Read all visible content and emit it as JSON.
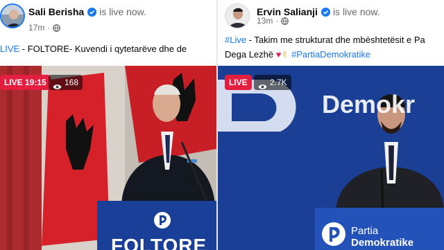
{
  "posts": [
    {
      "author": "Sali Berisha",
      "status": "is live now.",
      "time": "17m",
      "text_hashtag": "LIVE",
      "text_body": " - FOLTORE- Kuvendi i qytetarëve dhe de",
      "badge_live": "LIVE 19:15",
      "views": "168",
      "podium_text": "FOLTORE"
    },
    {
      "author": "Ervin Salianji",
      "status": "is live now.",
      "time": "13m",
      "text_hashtag": "#Live",
      "text_body": " - Takim me strukturat dhe mbështetësit e Pa",
      "line2_text": "Dega Lezhë ",
      "line2_hashtag": "#PartiaDemokratike",
      "badge_live": "LIVE",
      "views": "2.7K",
      "backdrop_text": "Demokr",
      "podium_line1": "Partia",
      "podium_line2": "Demokratike"
    }
  ],
  "icons": {
    "verified": "verified-badge-icon",
    "globe": "globe-icon",
    "eye": "eye-icon",
    "heart": "red-heart-emoji",
    "peace": "victory-hand-emoji",
    "party_logo": "partia-demokratike-logo"
  },
  "colors": {
    "accent": "#1877f2",
    "live_red": "#e41e3f",
    "party_blue": "#1b3e96"
  }
}
